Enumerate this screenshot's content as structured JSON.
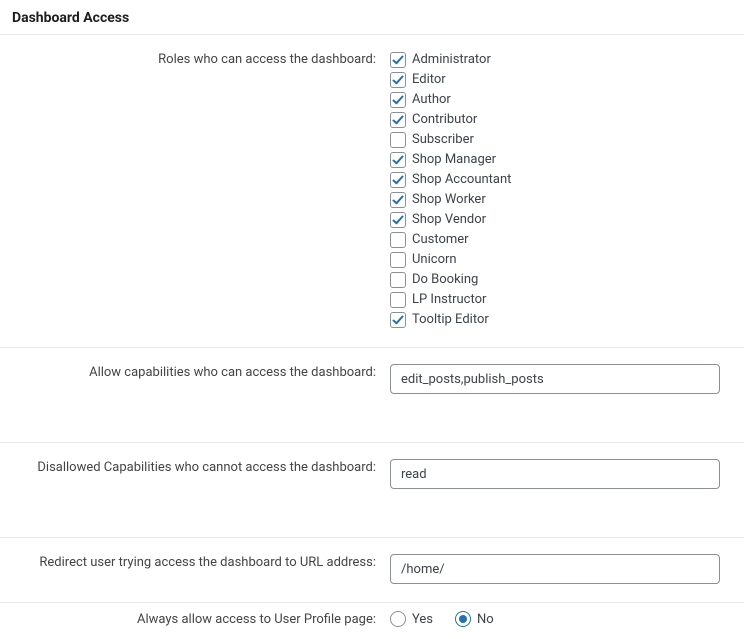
{
  "section": {
    "title": "Dashboard Access"
  },
  "roles": {
    "label": "Roles who can access the dashboard:",
    "items": [
      {
        "label": "Administrator",
        "checked": true
      },
      {
        "label": "Editor",
        "checked": true
      },
      {
        "label": "Author",
        "checked": true
      },
      {
        "label": "Contributor",
        "checked": true
      },
      {
        "label": "Subscriber",
        "checked": false
      },
      {
        "label": "Shop Manager",
        "checked": true
      },
      {
        "label": "Shop Accountant",
        "checked": true
      },
      {
        "label": "Shop Worker",
        "checked": true
      },
      {
        "label": "Shop Vendor",
        "checked": true
      },
      {
        "label": "Customer",
        "checked": false
      },
      {
        "label": "Unicorn",
        "checked": false
      },
      {
        "label": "Do Booking",
        "checked": false
      },
      {
        "label": "LP Instructor",
        "checked": false
      },
      {
        "label": "Tooltip Editor",
        "checked": true
      }
    ]
  },
  "allow_caps": {
    "label": "Allow capabilities who can access the dashboard:",
    "value": "edit_posts,publish_posts"
  },
  "disallow_caps": {
    "label": "Disallowed Capabilities who cannot access the dashboard:",
    "value": "read"
  },
  "redirect": {
    "label": "Redirect user trying access the dashboard to URL address:",
    "value": "/home/"
  },
  "profile_access": {
    "label": "Always allow access to User Profile page:",
    "options": {
      "yes": "Yes",
      "no": "No"
    },
    "selected": "no"
  }
}
